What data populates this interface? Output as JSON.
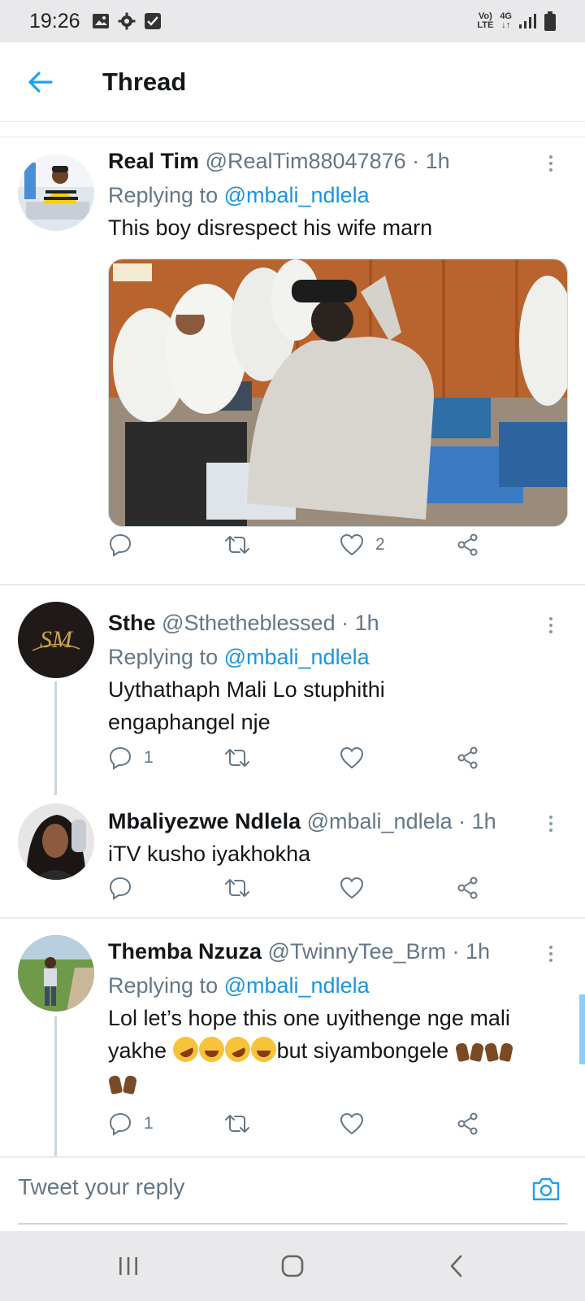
{
  "status_bar": {
    "time": "19:26",
    "left_icons": [
      "image-icon",
      "gear-icon",
      "checkbox-icon"
    ],
    "network_top": "Vo)",
    "network_bottom": "LTE",
    "net_type": "4G",
    "right_icons": [
      "signal-icon",
      "battery-icon"
    ]
  },
  "header": {
    "title": "Thread"
  },
  "tweets": [
    {
      "name": "Real Tim",
      "handle": "@RealTim88047876",
      "time": " · 1h",
      "replying_prefix": "Replying to ",
      "replying_to": "@mbali_ndlela",
      "text": "This boy disrespect his wife marn",
      "likes": "2"
    },
    {
      "name": "Sthe",
      "handle": "@Sthetheblessed",
      "time": " · 1h",
      "replying_prefix": "Replying to ",
      "replying_to": "@mbali_ndlela",
      "text": "Uythathaph Mali Lo stuphithi engaphangel nje",
      "replies": "1",
      "avatar_text": "SM"
    },
    {
      "name": "Mbaliyezwe Ndlela",
      "handle": "@mbali_ndlela",
      "time": " · 1h",
      "text": "iTV kusho iyakhokha"
    },
    {
      "name": "Themba Nzuza",
      "handle": "@TwinnyTee_Brm",
      "time": " · 1h",
      "replying_prefix": "Replying to ",
      "replying_to": "@mbali_ndlela",
      "text_part1": "Lol let’s hope this one uyithenge nge mali yakhe ",
      "text_part2": "but siyambongele ",
      "replies": "1"
    }
  ],
  "reply_bar": {
    "placeholder": "Tweet your reply"
  },
  "colors": {
    "accent": "#1da1f2",
    "link": "#1b95e0",
    "secondary_text": "#657786",
    "divider": "#e6ecf0"
  }
}
